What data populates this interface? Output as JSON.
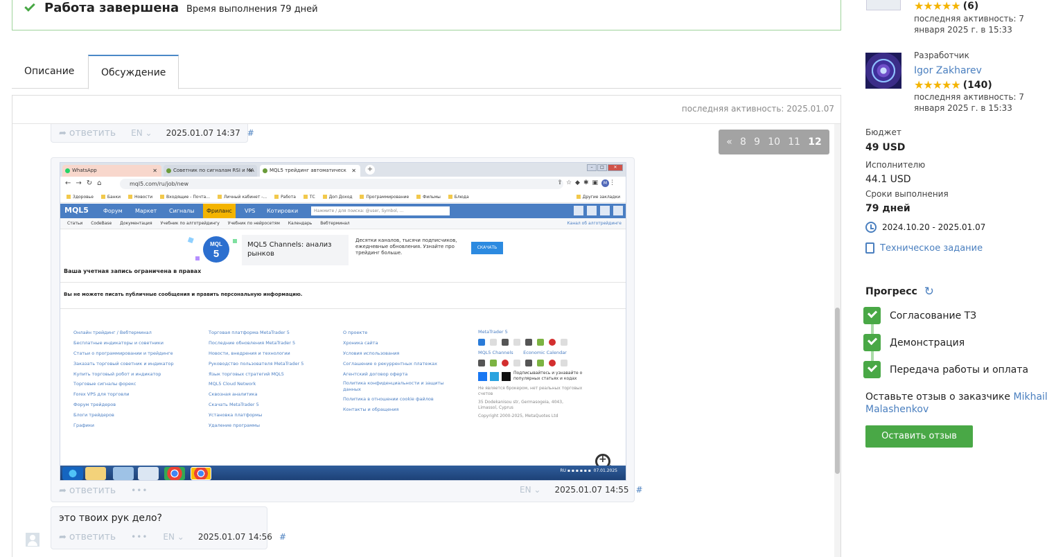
{
  "status": {
    "title": "Работа завершена",
    "duration": "Время выполнения 79 дней"
  },
  "tabs": [
    {
      "label": "Описание"
    },
    {
      "label": "Обсуждение"
    }
  ],
  "discussion": {
    "last_activity": "последняя активность: 2025.01.07",
    "pager": [
      "«",
      "8",
      "9",
      "10",
      "11",
      "12"
    ],
    "messages": [
      {
        "reply": "ответить",
        "lang": "EN",
        "time": "2025.01.07 14:37",
        "hash": "#"
      },
      {
        "reply": "ответить",
        "dots": "•••",
        "lang": "EN",
        "time": "2025.01.07 14:55",
        "hash": "#"
      },
      {
        "text": "это твоих рук дело?",
        "reply": "ответить",
        "dots": "•••",
        "lang": "EN",
        "time": "2025.01.07 14:56",
        "hash": "#"
      }
    ]
  },
  "screenshot": {
    "tabs": [
      "WhatsApp",
      "Советник по сигналам RSI и MA",
      "MQL5 трейдинг автоматическ"
    ],
    "url": "mql5.com/ru/job/new",
    "bookmarks": [
      "Здоровье",
      "Банки",
      "Новости",
      "Входящие - Почта...",
      "Личный кабинет -...",
      "Работа",
      "ТС",
      "Доп Доход",
      "Программирование",
      "Фильмы",
      "Блюда"
    ],
    "bookmarks_other": "Другие закладки",
    "mql_logo": "MQL5",
    "mql_menu": [
      "Форум",
      "Маркет",
      "Сигналы",
      "Фриланс",
      "VPS",
      "Котировки"
    ],
    "mql_search": "Нажмите / для поиска: @user, Symbol, ...",
    "subnav": [
      "Статьи",
      "CodeBase",
      "Документация",
      "Учебник по алготрейдингу",
      "Учебник по нейросетям",
      "Календарь",
      "Вебтерминал"
    ],
    "subnav_right": "Канал об алготрейдинге",
    "promo_title": "MQL5 Channels: анализ рынков",
    "promo_desc": "Десятки каналов, тысячи подписчиков, ежедневные обновления. Узнайте про трейдинг больше.",
    "promo_btn": "СКАЧАТЬ",
    "restricted": "Ваша учетная запись ограничена в правах",
    "restricted2": "Вы не можете писать публичные сообщения и править персональную информацию.",
    "col1": [
      "Онлайн трейдинг / Вебтерминал",
      "Бесплатные индикаторы и советники",
      "Статьи о программировании и трейдинге",
      "Заказать торговый советник и индикатор",
      "Купить торговый робот и индикатор",
      "Торговые сигналы форекс",
      "Forex VPS для торговли",
      "Форум трейдеров",
      "Блоги трейдеров",
      "Графики"
    ],
    "col2": [
      "Торговая платформа MetaTrader 5",
      "Последние обновления MetaTrader 5",
      "Новости, внедрения и технологии",
      "Руководство пользователя MetaTrader 5",
      "Язык торговых стратегий MQL5",
      "MQL5 Cloud Network",
      "Сквозная аналитика",
      "Скачать MetaTrader 5",
      "Установка платформы",
      "Удаление программы"
    ],
    "col3": [
      "О проекте",
      "Хроника сайта",
      "Условия использования",
      "Соглашение о рекуррентных платежах",
      "Агентский договор оферта",
      "Политика конфиденциальности и защиты данных",
      "Политика в отношении cookie файлов",
      "Контакты и обращения"
    ],
    "col4_mt5": "MetaTrader 5",
    "col4_channels": "MQL5 Channels",
    "col4_calendar": "Economic Calendar",
    "col4_subscribe": "Подписывайтесь и узнавайте о популярных статьях и кодах",
    "col4_disclaimer": "Не является брокером, нет реальных торговых счетов",
    "col4_address": "35 Dodekanisou str, Germasogeia, 4043, Limassol, Cyprus",
    "col4_copyright": "Copyright 2000-2025, MetaQuotes Ltd",
    "tray": "RU",
    "tray_date": "07.01.2025"
  },
  "sidebar": {
    "customer": {
      "stars": "★★★★★",
      "count": "(6)",
      "activity": "последняя активность: 7 января 2025 г. в 15:33"
    },
    "developer": {
      "role": "Разработчик",
      "name": "Igor Zakharev",
      "stars": "★★★★★",
      "count": "(140)",
      "activity": "последняя активность: 7 января 2025 г. в 15:33"
    },
    "budget_label": "Бюджет",
    "budget": "49 USD",
    "executor_label": "Исполнителю",
    "executor": "44.1 USD",
    "term_label": "Сроки выполнения",
    "term": "79 дней",
    "dates": "2024.10.20 - 2025.01.07",
    "spec": "Техническое задание",
    "progress_title": "Прогресс",
    "steps": [
      "Согласование ТЗ",
      "Демонстрация",
      "Передача работы и оплата"
    ],
    "review_prefix": "Оставьте отзыв о заказчике",
    "review_name": "Mikhail Malashenkov",
    "review_btn": "Оставить отзыв"
  }
}
